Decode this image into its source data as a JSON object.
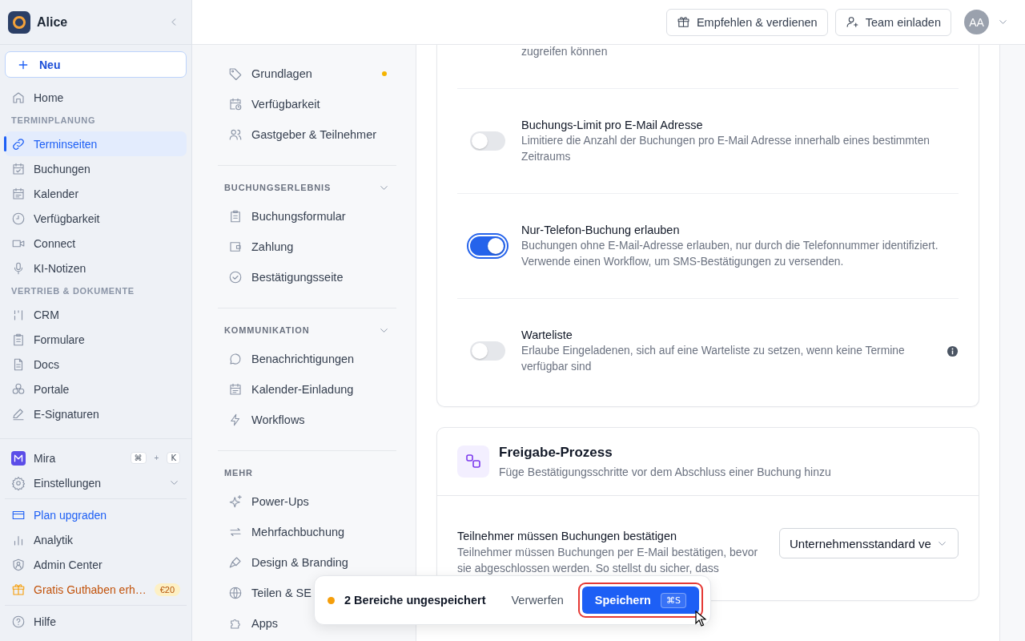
{
  "sidebar": {
    "workspace": "Alice",
    "new_button": "Neu",
    "home": {
      "label": "Home",
      "selected": false
    },
    "sections": [
      {
        "title": "TERMINPLANUNG",
        "items": [
          {
            "label": "Terminseiten",
            "selected": true
          },
          {
            "label": "Buchungen",
            "selected": false
          },
          {
            "label": "Kalender",
            "selected": false
          },
          {
            "label": "Verfügbarkeit",
            "selected": false
          },
          {
            "label": "Connect",
            "selected": false
          },
          {
            "label": "KI-Notizen",
            "selected": false
          }
        ]
      },
      {
        "title": "VERTRIEB & DOKUMENTE",
        "items": [
          {
            "label": "CRM",
            "selected": false
          },
          {
            "label": "Formulare",
            "selected": false
          },
          {
            "label": "Docs",
            "selected": false
          },
          {
            "label": "Portale",
            "selected": false
          },
          {
            "label": "E-Signaturen",
            "selected": false
          }
        ]
      }
    ],
    "assistant": {
      "label": "Mira",
      "keys": [
        "⌘",
        "K"
      ],
      "joiner": "+"
    },
    "settings": {
      "label": "Einstellungen",
      "expanded": false
    },
    "links": [
      {
        "kind": "upgrade",
        "label": "Plan upgraden"
      },
      {
        "kind": "plain",
        "label": "Analytik"
      },
      {
        "kind": "plain",
        "label": "Admin Center"
      },
      {
        "kind": "promo",
        "label": "Gratis Guthaben erh…",
        "badge": "€20"
      }
    ],
    "help": "Hilfe"
  },
  "header": {
    "buttons": [
      "Empfehlen & verdienen",
      "Team einladen"
    ],
    "avatar": "AA"
  },
  "event_nav": {
    "groups": [
      {
        "items": [
          {
            "label": "Grundlagen",
            "selected": false,
            "unsaved": true
          },
          {
            "label": "Verfügbarkeit",
            "selected": false,
            "unsaved": false
          },
          {
            "label": "Gastgeber & Teilnehmer",
            "selected": false,
            "unsaved": false
          }
        ]
      },
      {
        "title": "BUCHUNGSERLEBNIS",
        "expanded": true,
        "items": [
          {
            "label": "Buchungsformular",
            "selected": false,
            "unsaved": false
          },
          {
            "label": "Zahlung",
            "selected": false,
            "unsaved": false
          },
          {
            "label": "Bestätigungsseite",
            "selected": false,
            "unsaved": false
          }
        ]
      },
      {
        "title": "KOMMUNIKATION",
        "expanded": true,
        "items": [
          {
            "label": "Benachrichtigungen",
            "selected": false,
            "unsaved": false
          },
          {
            "label": "Kalender-Einladung",
            "selected": false,
            "unsaved": false
          },
          {
            "label": "Workflows",
            "selected": false,
            "unsaved": false
          }
        ]
      },
      {
        "title": "MEHR",
        "items": [
          {
            "label": "Power-Ups",
            "selected": false,
            "unsaved": false
          },
          {
            "label": "Mehrfachbuchung",
            "selected": false,
            "unsaved": false
          },
          {
            "label": "Design & Branding",
            "selected": false,
            "unsaved": false
          },
          {
            "label": "Teilen & SE",
            "selected": false,
            "unsaved": false
          },
          {
            "label": "Apps",
            "selected": false,
            "unsaved": false
          }
        ]
      }
    ]
  },
  "settings_card": {
    "overflow_text": "zugreifen können",
    "rows": [
      {
        "title": "Buchungs-Limit pro E-Mail Adresse",
        "description": "Limitiere die Anzahl der Buchungen pro E-Mail Adresse innerhalb eines bestimmten Zeitraums",
        "on": false,
        "info": false
      },
      {
        "title": "Nur-Telefon-Buchung erlauben",
        "description": "Buchungen ohne E-Mail-Adresse erlauben, nur durch die Telefonnummer identifiziert. Verwende einen Workflow, um SMS-Bestätigungen zu versenden.",
        "on": true,
        "info": false
      },
      {
        "title": "Warteliste",
        "description": "Erlaube Eingeladenen, sich auf eine Warteliste zu setzen, wenn keine Termine verfügbar sind",
        "on": false,
        "info": true
      }
    ]
  },
  "approval_card": {
    "title": "Freigabe-Prozess",
    "subtitle": "Füge Bestätigungsschritte vor dem Abschluss einer Buchung hinzu",
    "rows": [
      {
        "title": "Teilnehmer müssen Buchungen bestätigen",
        "description": "Teilnehmer müssen Buchungen per E-Mail bestätigen, bevor sie abgeschlossen werden. So stellst du sicher, dass",
        "select": "Unternehmensstandard ve"
      }
    ]
  },
  "save_bar": {
    "message": "2 Bereiche ungespeichert",
    "discard": "Verwerfen",
    "save": "Speichern",
    "shortcut": "⌘S",
    "highlighted": true
  }
}
